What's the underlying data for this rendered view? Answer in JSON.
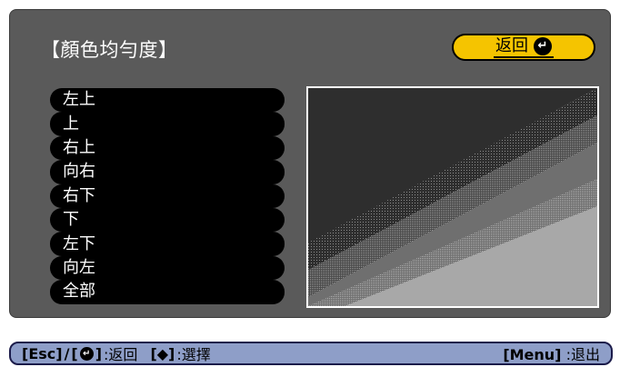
{
  "title": "【顏色均勻度】",
  "back_button": {
    "label": "返回",
    "icon": "enter-icon"
  },
  "menu_items": [
    {
      "label": "左上"
    },
    {
      "label": "上"
    },
    {
      "label": "右上"
    },
    {
      "label": "向右"
    },
    {
      "label": "右下"
    },
    {
      "label": "下"
    },
    {
      "label": "左下"
    },
    {
      "label": "向左"
    },
    {
      "label": "全部"
    }
  ],
  "preview": {
    "description_colors": [
      "#2e2e2e",
      "#6f6f6f",
      "#a8a8a8"
    ]
  },
  "footer": {
    "esc_key": "[Esc]",
    "slash": "/",
    "enter_open": "[",
    "enter_close": "]",
    "back_text": ":返回",
    "arrow_key": "[◆]",
    "select_text": ":選擇",
    "menu_key": "[Menu]",
    "exit_text": ":退出"
  },
  "colors": {
    "panel": "#5a5a5a",
    "accent": "#f5c400",
    "footer": "#8e9ec8"
  }
}
